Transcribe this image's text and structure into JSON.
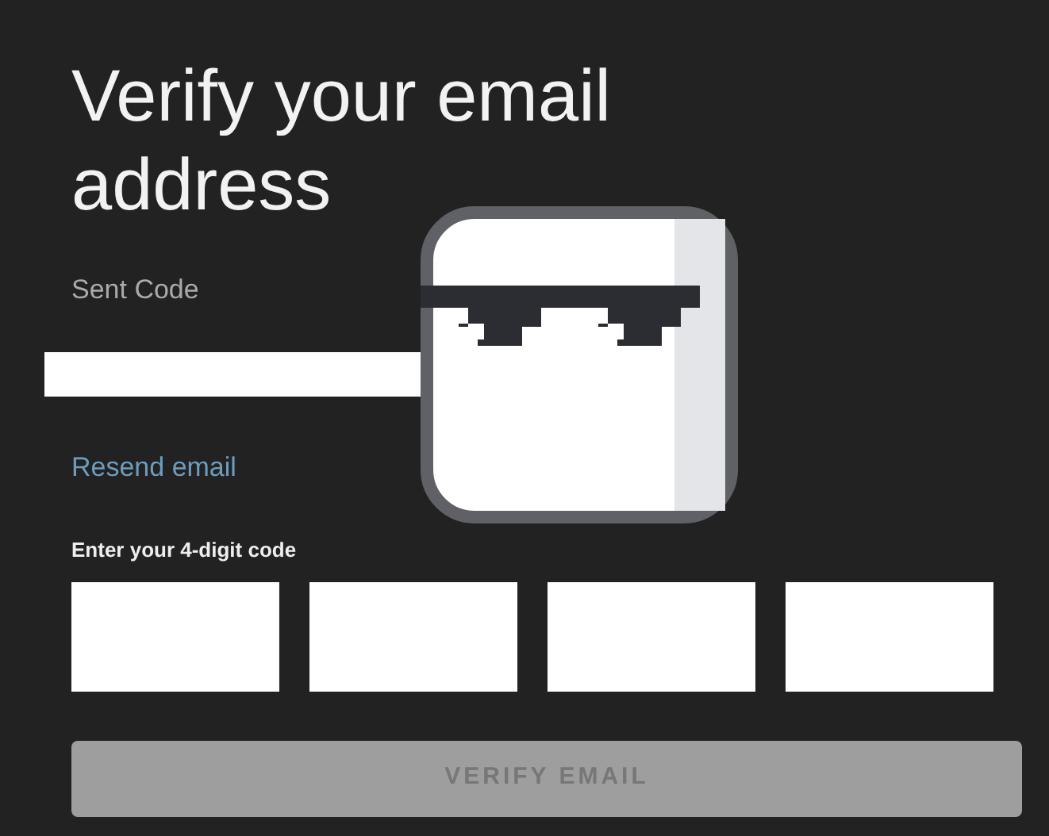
{
  "heading": "Verify your email address",
  "sent_code": {
    "label": "Sent Code",
    "redacted": true
  },
  "resend_link": "Resend email",
  "code_entry": {
    "label": "Enter your 4-digit code",
    "digits": [
      {
        "focused": false
      },
      {
        "focused": false
      },
      {
        "focused": false
      },
      {
        "focused": false
      }
    ]
  },
  "verify_button": {
    "label": "VERIFY EMAIL",
    "disabled": true
  },
  "sticker": {
    "kind": "sunglasses"
  }
}
